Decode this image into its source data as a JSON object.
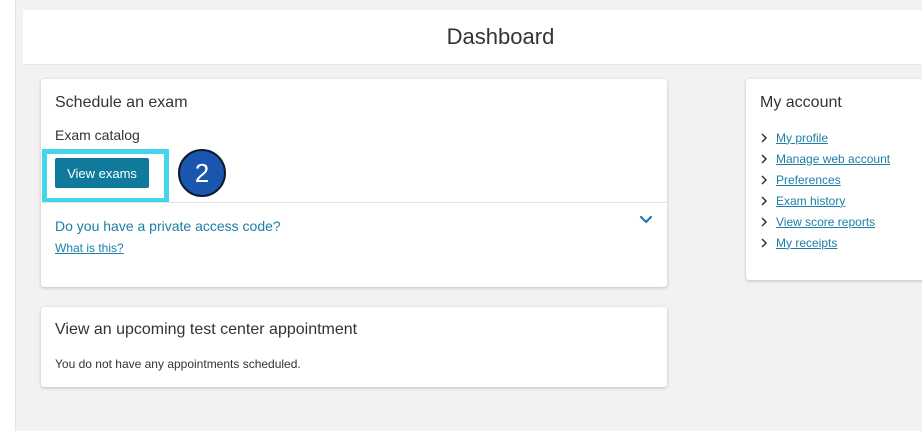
{
  "header": {
    "title": "Dashboard"
  },
  "schedule": {
    "title": "Schedule an exam",
    "subtitle": "Exam catalog",
    "view_button": "View exams",
    "step_badge": "2",
    "private_question": "Do you have a private access code?",
    "what_link": "What is this?"
  },
  "upcoming": {
    "title": "View an upcoming test center appointment",
    "message": "You do not have any appointments scheduled."
  },
  "account": {
    "title": "My account",
    "links": [
      {
        "label": "My profile"
      },
      {
        "label": "Manage web account"
      },
      {
        "label": "Preferences"
      },
      {
        "label": "Exam history"
      },
      {
        "label": "View score reports"
      },
      {
        "label": "My receipts"
      }
    ]
  },
  "colors": {
    "accent": "#0f7a9b",
    "link": "#1b7fa6",
    "highlight": "#43d5e8",
    "badge": "#1a56b0"
  },
  "icons": {
    "chevron": "chevron-down-icon",
    "arrow": "chevron-right-icon"
  }
}
